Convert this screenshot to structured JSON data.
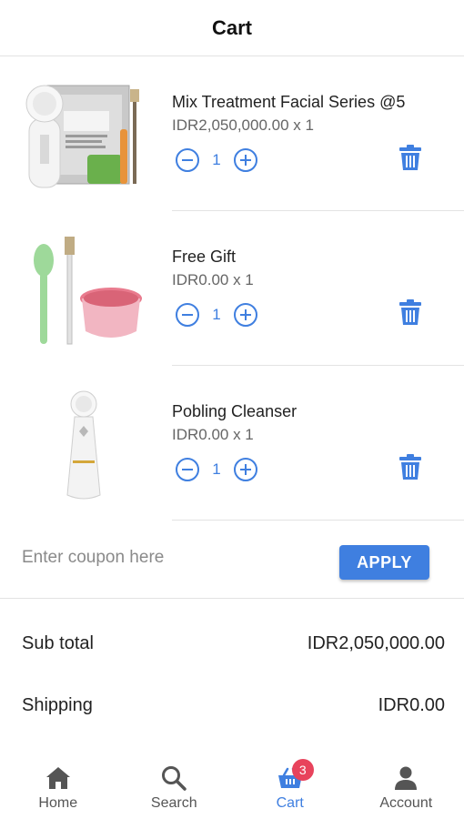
{
  "header": {
    "title": "Cart"
  },
  "items": [
    {
      "name": "Mix Treatment Facial Series @5",
      "price": "IDR2,050,000.00 x 1",
      "qty": "1"
    },
    {
      "name": "Free Gift",
      "price": "IDR0.00 x 1",
      "qty": "1"
    },
    {
      "name": "Pobling Cleanser",
      "price": "IDR0.00 x 1",
      "qty": "1"
    }
  ],
  "coupon": {
    "placeholder": "Enter coupon here",
    "value": "",
    "apply_label": "APPLY"
  },
  "summary": {
    "subtotal_label": "Sub total",
    "subtotal_value": "IDR2,050,000.00",
    "shipping_label": "Shipping",
    "shipping_value": "IDR0.00"
  },
  "nav": {
    "items": [
      {
        "label": "Home",
        "icon": "home-icon"
      },
      {
        "label": "Search",
        "icon": "search-icon"
      },
      {
        "label": "Cart",
        "icon": "cart-icon",
        "badge": "3",
        "active": true
      },
      {
        "label": "Account",
        "icon": "account-icon"
      }
    ]
  },
  "colors": {
    "accent": "#3f7fe0",
    "badge": "#e8435c"
  }
}
